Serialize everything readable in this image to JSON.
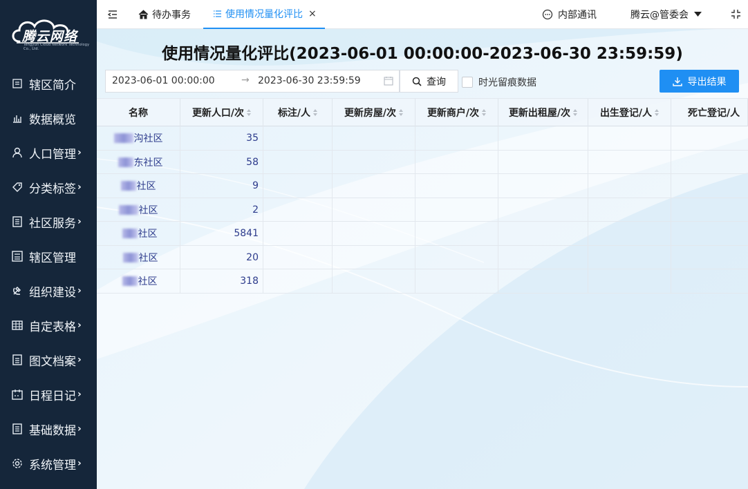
{
  "sidebar": {
    "brand": "腾云网络",
    "brand_sub": "Tengyun Cloud Network Technology Co., Ltd.",
    "items": [
      {
        "label": "辖区简介",
        "icon": "map-icon",
        "arrow": ""
      },
      {
        "label": "数据概览",
        "icon": "bar-chart-icon",
        "arrow": ""
      },
      {
        "label": "人口管理",
        "icon": "user-icon",
        "arrow": "›"
      },
      {
        "label": "分类标签",
        "icon": "tag-icon",
        "arrow": "›"
      },
      {
        "label": "社区服务",
        "icon": "document-icon",
        "arrow": "›"
      },
      {
        "label": "辖区管理",
        "icon": "building-icon",
        "arrow": ""
      },
      {
        "label": "组织建设",
        "icon": "hammer-sickle-icon",
        "arrow": "›"
      },
      {
        "label": "自定表格",
        "icon": "grid-icon",
        "arrow": "›"
      },
      {
        "label": "图文档案",
        "icon": "archive-icon",
        "arrow": "›"
      },
      {
        "label": "日程日记",
        "icon": "calendar-icon",
        "arrow": "›"
      },
      {
        "label": "基础数据",
        "icon": "list-icon",
        "arrow": "›"
      },
      {
        "label": "系统管理",
        "icon": "gear-icon",
        "arrow": "›"
      }
    ]
  },
  "topbar": {
    "tabs": [
      {
        "label": "待办事务",
        "icon": "home-icon",
        "active": false
      },
      {
        "label": "使用情况量化评比",
        "icon": "list-icon",
        "active": true,
        "close": "×"
      }
    ],
    "messages_label": "内部通讯",
    "user_label": "腾云@管委会"
  },
  "page": {
    "title": "使用情况量化评比(2023-06-01 00:00:00-2023-06-30 23:59:59)"
  },
  "filter": {
    "start": "2023-06-01 00:00:00",
    "separator": "→",
    "end": "2023-06-30 23:59:59",
    "query_label": "查询",
    "checkbox_label": "时光留痕数据",
    "export_label": "导出结果"
  },
  "table": {
    "columns": [
      "名称",
      "更新人口/次",
      "标注/人",
      "更新房屋/次",
      "更新商户/次",
      "更新出租屋/次",
      "出生登记/人",
      "死亡登记/人"
    ],
    "rows": [
      {
        "name_suffix": "沟社区",
        "population": "35"
      },
      {
        "name_suffix": "东社区",
        "population": "58"
      },
      {
        "name_suffix": "社区",
        "population": "9"
      },
      {
        "name_suffix": "社区",
        "population": "2"
      },
      {
        "name_suffix": "社区",
        "population": "5841"
      },
      {
        "name_suffix": "社区",
        "population": "20"
      },
      {
        "name_suffix": "社区",
        "population": "318"
      }
    ]
  },
  "colors": {
    "sidebar_bg": "#15263a",
    "accent": "#1f8ff3",
    "link_text": "#2d3b8c"
  }
}
